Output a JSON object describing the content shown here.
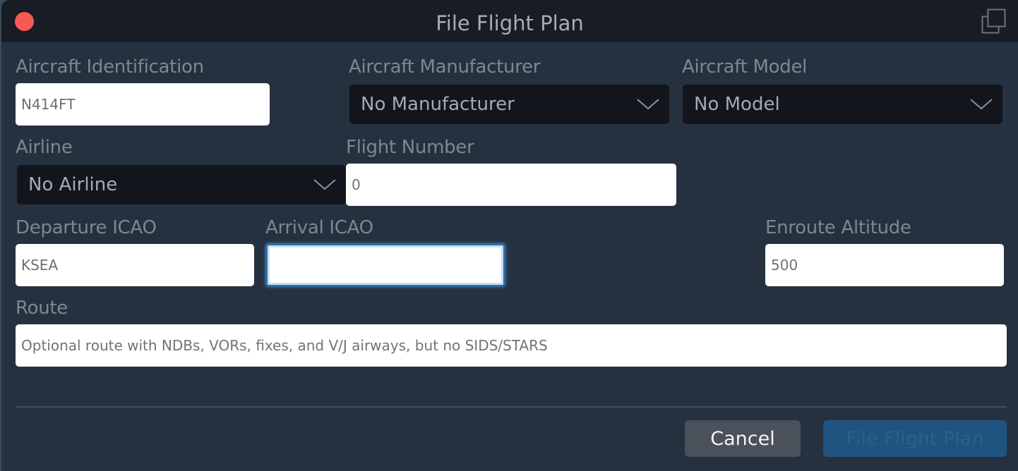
{
  "window": {
    "title": "File Flight Plan"
  },
  "fields": {
    "aircraft_id": {
      "label": "Aircraft Identification",
      "value": "N414FT"
    },
    "manufacturer": {
      "label": "Aircraft Manufacturer",
      "value": "No Manufacturer"
    },
    "model": {
      "label": "Aircraft Model",
      "value": "No Model"
    },
    "airline": {
      "label": "Airline",
      "value": "No Airline"
    },
    "flight_number": {
      "label": "Flight Number",
      "placeholder": "0",
      "value": ""
    },
    "departure": {
      "label": "Departure ICAO",
      "value": "KSEA"
    },
    "arrival": {
      "label": "Arrival ICAO",
      "value": ""
    },
    "altitude": {
      "label": "Enroute Altitude",
      "placeholder": "500",
      "value": ""
    },
    "route": {
      "label": "Route",
      "placeholder": "Optional route with NDBs, VORs, fixes, and V/J airways, but no SIDS/STARS",
      "value": ""
    }
  },
  "buttons": {
    "cancel": "Cancel",
    "file": "File Flight Plan"
  },
  "colors": {
    "close": "#f85a53",
    "primary": "#1f5480",
    "background": "#263140"
  }
}
